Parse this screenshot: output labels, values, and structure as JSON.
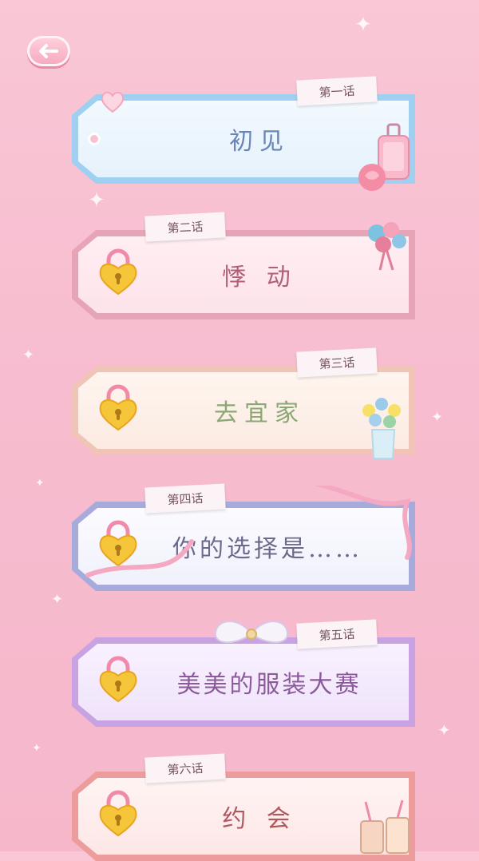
{
  "back": {
    "icon": "arrow-left-icon"
  },
  "chapters": [
    {
      "tag": "第一话",
      "title": "初见",
      "locked": false
    },
    {
      "tag": "第二话",
      "title": "悸 动",
      "locked": true
    },
    {
      "tag": "第三话",
      "title": "去宜家",
      "locked": true
    },
    {
      "tag": "第四话",
      "title": "你的选择是……",
      "locked": true
    },
    {
      "tag": "第五话",
      "title": "美美的服装大赛",
      "locked": true
    },
    {
      "tag": "第六话",
      "title": "约 会",
      "locked": true
    }
  ],
  "colors": {
    "background": "#f7bccf",
    "lock_gold": "#f5c63a",
    "lock_shackle": "#f08aa8"
  }
}
